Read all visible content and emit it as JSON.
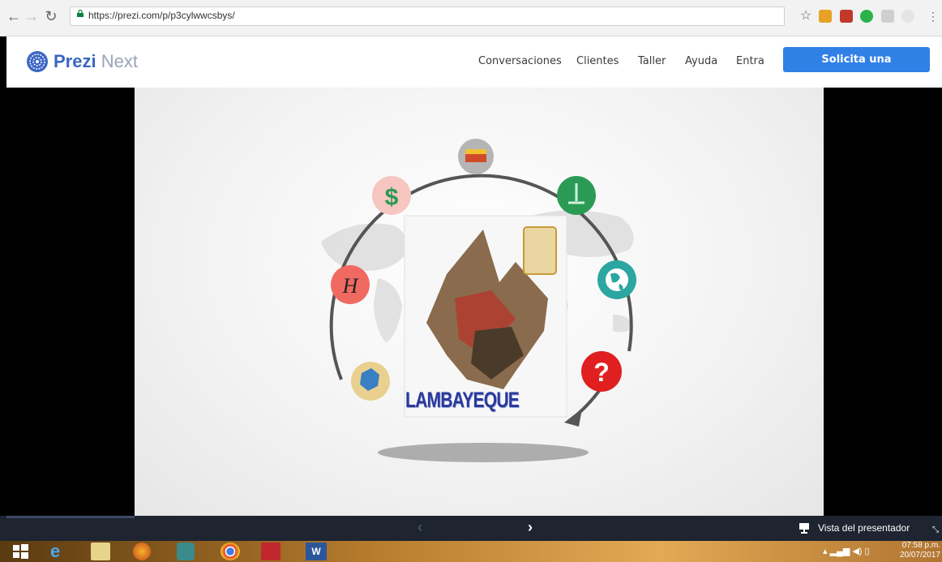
{
  "browser": {
    "url": "https://prezi.com/p/p3cylwwcsbys/",
    "back_icon": "back-arrow-icon",
    "forward_icon": "forward-arrow-icon",
    "reload_icon": "reload-icon"
  },
  "header": {
    "logo_brand": "Prezi",
    "logo_product": "Next",
    "nav": [
      "Conversaciones",
      "Clientes",
      "Taller",
      "Ayuda",
      "Entra"
    ],
    "cta_label": "Solicita una demostración"
  },
  "slide": {
    "title": "LAMBAYEQUE",
    "icons": [
      "flag-icon",
      "water-fountain-icon",
      "globe-icon",
      "question-icon",
      "map-icon",
      "history-icon",
      "dollar-icon"
    ],
    "symbols": {
      "dollar": "$",
      "history": "H",
      "question": "?"
    }
  },
  "presenter_bar": {
    "prev": "‹",
    "next": "›",
    "presenter_label": "Vista del presentador"
  },
  "taskbar": {
    "time": "07:58 p.m.",
    "date": "20/07/2017"
  },
  "colors": {
    "accent": "#3180e6",
    "brand": "#3b66c4"
  }
}
